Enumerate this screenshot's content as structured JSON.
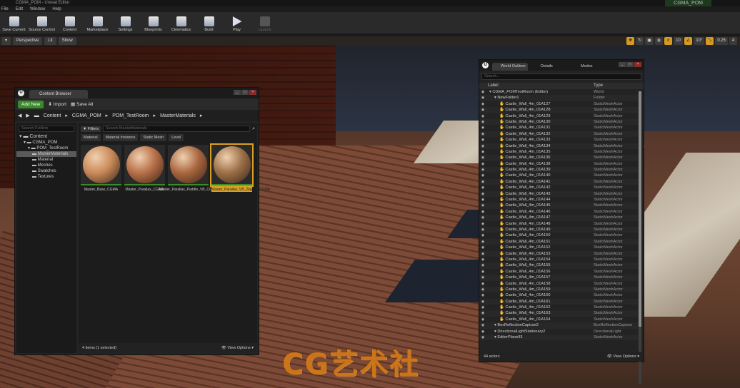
{
  "window": {
    "app_title": "CGMA_POM - Unreal Editor",
    "project_tab": "CGMA_POM"
  },
  "menu": [
    "File",
    "Edit",
    "Window",
    "Help"
  ],
  "toolbar": [
    "Save Current",
    "Source Control",
    "Content",
    "Marketplace",
    "Settings",
    "Blueprints",
    "Cinematics",
    "Build",
    "Play",
    "Launch"
  ],
  "viewport": {
    "perspective": "Perspective",
    "lit": "Lit",
    "show": "Show",
    "grid_snap": "10",
    "rot_snap": "10°",
    "scale_snap": "0.25",
    "cam_speed": "4"
  },
  "content_browser": {
    "tab": "Content Browser",
    "add_new": "Add New",
    "import": "Import",
    "save_all": "Save All",
    "path": [
      "Content",
      "CGMA_POM",
      "POM_TestRoom",
      "MasterMaterials"
    ],
    "search_folders": "Search Folders",
    "tree": [
      "Content",
      "CGMA_POM",
      "POM_TestRoom",
      "MasterMaterials",
      "Material",
      "Meshes",
      "Swatches",
      "Textures"
    ],
    "filters": "Filters",
    "search_assets": "Search MasterMaterials",
    "chips": [
      "Material",
      "Material Instance",
      "Static Mesh",
      "Level"
    ],
    "assets": [
      {
        "name": "Master_Base_CGMA",
        "color": "#c98a58",
        "selected": false
      },
      {
        "name": "Master_Parallax_CGMA",
        "color": "#b86f48",
        "selected": false
      },
      {
        "name": "Master_Parallax_Puddle_VB_CGMA",
        "color": "#a9663f",
        "selected": false
      },
      {
        "name": "Master_Parallax_VB_2layers_CGMA",
        "color": "#9c7048",
        "selected": true
      }
    ],
    "status": "4 items (1 selected)",
    "view_options": "View Options"
  },
  "outliner": {
    "tabs": [
      "World Outliner",
      "Details",
      "Modes"
    ],
    "search": "Search...",
    "col_label": "Label",
    "col_type": "Type",
    "rows": [
      {
        "label": "CGMA_POMTestRoom (Editor)",
        "type": "World",
        "indent": 0
      },
      {
        "label": "NewFolder1",
        "type": "Folder",
        "indent": 1
      },
      {
        "label": "Castle_Wall_4m_01A127",
        "type": "StaticMeshActor",
        "indent": 2
      },
      {
        "label": "Castle_Wall_4m_01A128",
        "type": "StaticMeshActor",
        "indent": 2
      },
      {
        "label": "Castle_Wall_4m_01A129",
        "type": "StaticMeshActor",
        "indent": 2
      },
      {
        "label": "Castle_Wall_4m_01A130",
        "type": "StaticMeshActor",
        "indent": 2
      },
      {
        "label": "Castle_Wall_4m_01A131",
        "type": "StaticMeshActor",
        "indent": 2
      },
      {
        "label": "Castle_Wall_4m_01A132",
        "type": "StaticMeshActor",
        "indent": 2
      },
      {
        "label": "Castle_Wall_4m_01A133",
        "type": "StaticMeshActor",
        "indent": 2
      },
      {
        "label": "Castle_Wall_4m_01A134",
        "type": "StaticMeshActor",
        "indent": 2
      },
      {
        "label": "Castle_Wall_4m_01A135",
        "type": "StaticMeshActor",
        "indent": 2
      },
      {
        "label": "Castle_Wall_4m_01A136",
        "type": "StaticMeshActor",
        "indent": 2
      },
      {
        "label": "Castle_Wall_4m_01A138",
        "type": "StaticMeshActor",
        "indent": 2
      },
      {
        "label": "Castle_Wall_4m_01A139",
        "type": "StaticMeshActor",
        "indent": 2
      },
      {
        "label": "Castle_Wall_4m_01A140",
        "type": "StaticMeshActor",
        "indent": 2
      },
      {
        "label": "Castle_Wall_4m_01A141",
        "type": "StaticMeshActor",
        "indent": 2
      },
      {
        "label": "Castle_Wall_4m_01A142",
        "type": "StaticMeshActor",
        "indent": 2
      },
      {
        "label": "Castle_Wall_4m_01A143",
        "type": "StaticMeshActor",
        "indent": 2
      },
      {
        "label": "Castle_Wall_4m_01A144",
        "type": "StaticMeshActor",
        "indent": 2
      },
      {
        "label": "Castle_Wall_4m_01A145",
        "type": "StaticMeshActor",
        "indent": 2
      },
      {
        "label": "Castle_Wall_4m_01A146",
        "type": "StaticMeshActor",
        "indent": 2
      },
      {
        "label": "Castle_Wall_4m_01A147",
        "type": "StaticMeshActor",
        "indent": 2
      },
      {
        "label": "Castle_Wall_4m_01A148",
        "type": "StaticMeshActor",
        "indent": 2
      },
      {
        "label": "Castle_Wall_4m_01A149",
        "type": "StaticMeshActor",
        "indent": 2
      },
      {
        "label": "Castle_Wall_4m_01A150",
        "type": "StaticMeshActor",
        "indent": 2
      },
      {
        "label": "Castle_Wall_4m_01A151",
        "type": "StaticMeshActor",
        "indent": 2
      },
      {
        "label": "Castle_Wall_4m_01A152",
        "type": "StaticMeshActor",
        "indent": 2
      },
      {
        "label": "Castle_Wall_4m_01A153",
        "type": "StaticMeshActor",
        "indent": 2
      },
      {
        "label": "Castle_Wall_4m_01A154",
        "type": "StaticMeshActor",
        "indent": 2
      },
      {
        "label": "Castle_Wall_4m_01A155",
        "type": "StaticMeshActor",
        "indent": 2
      },
      {
        "label": "Castle_Wall_4m_01A156",
        "type": "StaticMeshActor",
        "indent": 2
      },
      {
        "label": "Castle_Wall_4m_01A157",
        "type": "StaticMeshActor",
        "indent": 2
      },
      {
        "label": "Castle_Wall_4m_01A158",
        "type": "StaticMeshActor",
        "indent": 2
      },
      {
        "label": "Castle_Wall_4m_01A159",
        "type": "StaticMeshActor",
        "indent": 2
      },
      {
        "label": "Castle_Wall_4m_01A160",
        "type": "StaticMeshActor",
        "indent": 2
      },
      {
        "label": "Castle_Wall_4m_01A161",
        "type": "StaticMeshActor",
        "indent": 2
      },
      {
        "label": "Castle_Wall_4m_01A162",
        "type": "StaticMeshActor",
        "indent": 2
      },
      {
        "label": "Castle_Wall_4m_01A163",
        "type": "StaticMeshActor",
        "indent": 2
      },
      {
        "label": "Castle_Wall_4m_01A164",
        "type": "StaticMeshActor",
        "indent": 2
      },
      {
        "label": "BoxReflectionCapture2",
        "type": "BoxReflectionCapture",
        "indent": 1
      },
      {
        "label": "DirectionalLightStationary2",
        "type": "DirectionalLight",
        "indent": 1
      },
      {
        "label": "EditorPlane93",
        "type": "StaticMeshActor",
        "indent": 1
      }
    ],
    "count": "44 actors",
    "view_options": "View Options"
  },
  "watermark": "CG艺术社"
}
